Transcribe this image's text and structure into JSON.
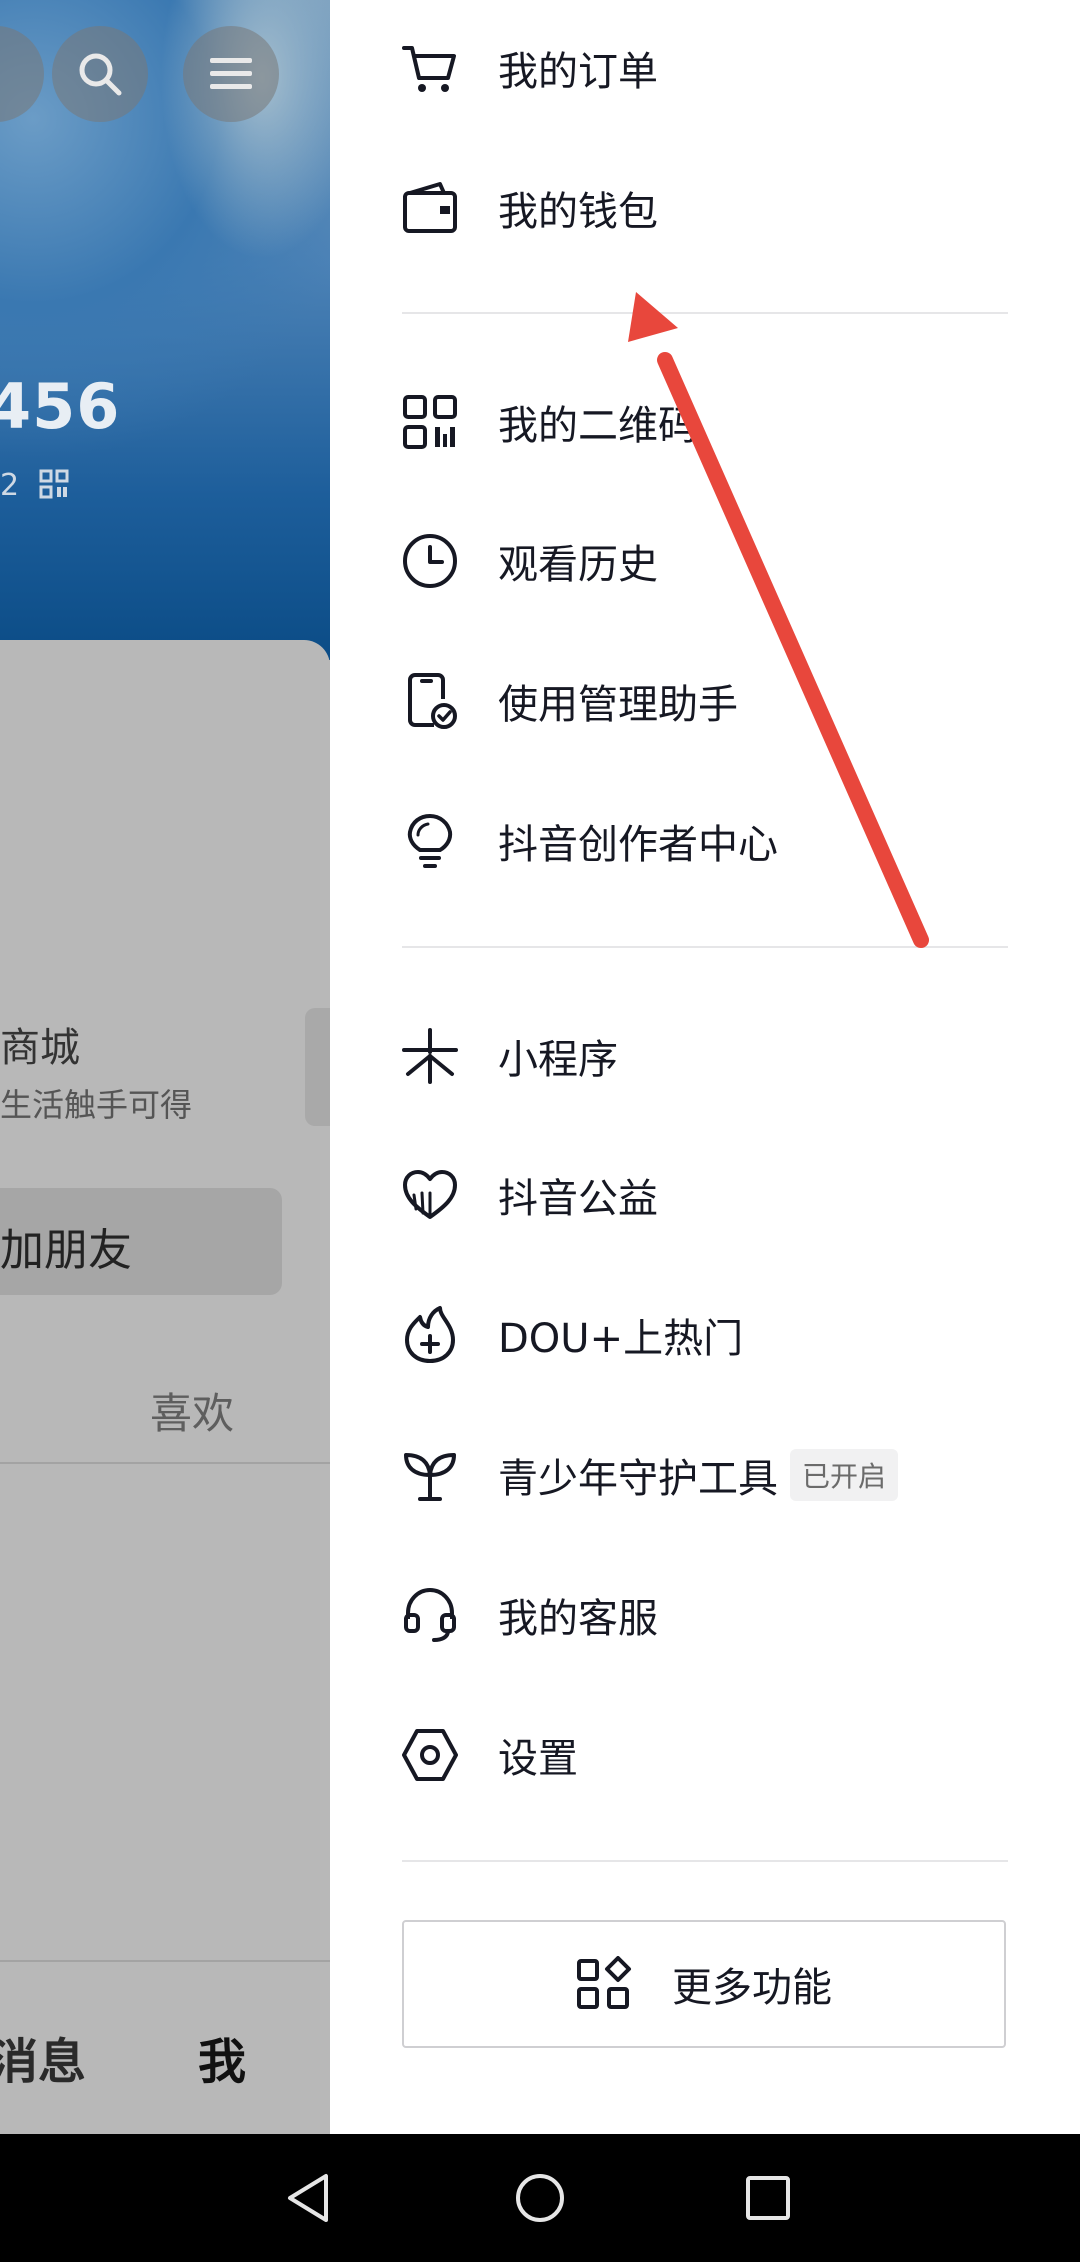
{
  "background_page": {
    "stat_partial": "456",
    "stat_sub_partial": "2",
    "mall_title_partial": "商城",
    "mall_sub_partial": "生活触手可得",
    "add_friend_partial": "加朋友",
    "likes_tab": "喜欢",
    "nav_messages_partial": "消息",
    "nav_me": "我",
    "icons": [
      "search-icon",
      "menu-icon",
      "qr-icon"
    ]
  },
  "drawer": {
    "group1": [
      {
        "label": "我的订单",
        "icon": "cart-icon"
      },
      {
        "label": "我的钱包",
        "icon": "wallet-icon"
      }
    ],
    "group2": [
      {
        "label": "我的二维码",
        "icon": "qr-code-icon"
      },
      {
        "label": "观看历史",
        "icon": "clock-icon"
      },
      {
        "label": "使用管理助手",
        "icon": "phone-check-icon"
      },
      {
        "label": "抖音创作者中心",
        "icon": "lightbulb-icon"
      }
    ],
    "group3": [
      {
        "label": "小程序",
        "icon": "mini-program-icon"
      },
      {
        "label": "抖音公益",
        "icon": "heart-icon"
      },
      {
        "label": "DOU+上热门",
        "icon": "flame-plus-icon"
      },
      {
        "label": "青少年守护工具",
        "icon": "sprout-icon",
        "badge": "已开启"
      },
      {
        "label": "我的客服",
        "icon": "headset-icon"
      },
      {
        "label": "设置",
        "icon": "settings-hexagon-icon"
      }
    ],
    "more_button": {
      "label": "更多功能",
      "icon": "grid-diamond-icon"
    }
  },
  "annotation": {
    "color": "#e8473c"
  },
  "system_nav": [
    "back-icon",
    "home-icon",
    "recents-icon"
  ]
}
